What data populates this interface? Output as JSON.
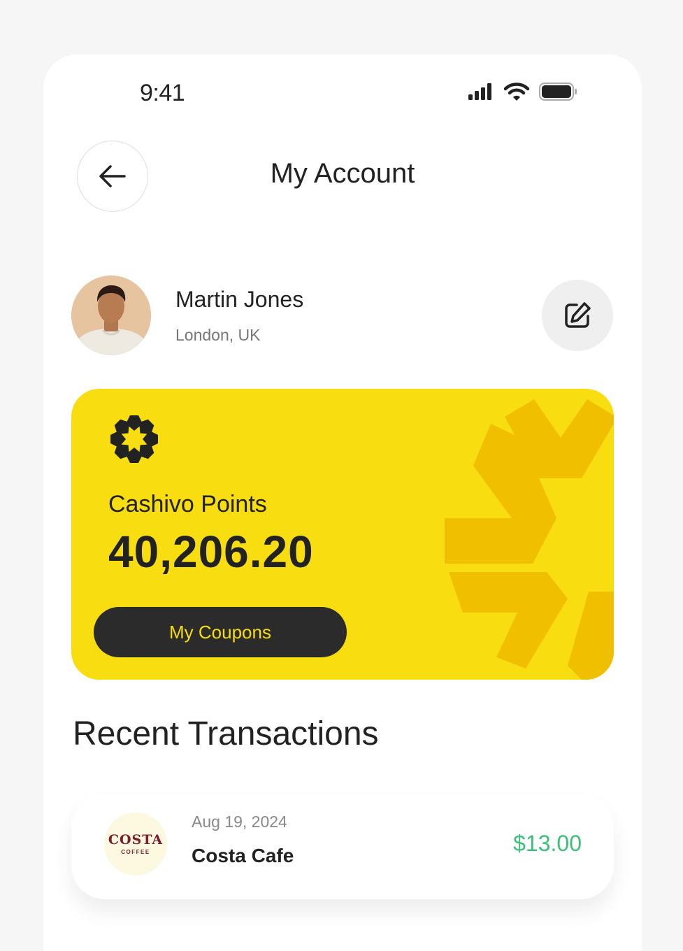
{
  "status_bar": {
    "time": "9:41",
    "icons": [
      "signal-icon",
      "wifi-icon",
      "battery-icon"
    ]
  },
  "header": {
    "title": "My Account",
    "back_icon": "arrow-left-icon"
  },
  "profile": {
    "name": "Martin Jones",
    "location": "London, UK",
    "edit_icon": "edit-icon"
  },
  "points_card": {
    "label": "Cashivo Points",
    "value": "40,206.20",
    "coupons_label": "My Coupons",
    "colors": {
      "background": "#f8dd10",
      "deco": "#f0c000",
      "button": "#2b2b2b"
    }
  },
  "transactions": {
    "title": "Recent Transactions",
    "items": [
      {
        "brand": "COSTA",
        "brand_sub": "COFFEE",
        "date": "Aug 19, 2024",
        "merchant": "Costa Cafe",
        "amount": "$13.00",
        "amount_color": "#3dbf7a"
      }
    ]
  }
}
